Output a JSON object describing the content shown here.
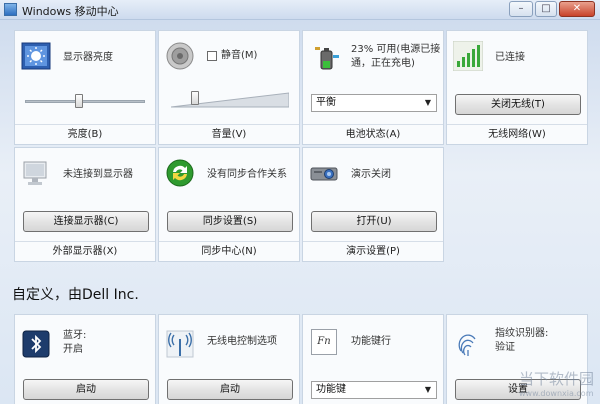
{
  "window": {
    "title": "Windows 移动中心",
    "controls": [
      "–",
      "□",
      "✕"
    ]
  },
  "tiles": {
    "brightness": {
      "label": "显示器亮度",
      "footer": "亮度(B)",
      "level": 0.45
    },
    "volume": {
      "mute_label": "静音(M)",
      "footer": "音量(V)",
      "level": 0.2
    },
    "battery": {
      "status": "23% 可用(电源已接通，正在充电)",
      "plan": "平衡",
      "footer": "电池状态(A)"
    },
    "wireless": {
      "status": "已连接",
      "button": "关闭无线(T)",
      "footer": "无线网络(W)"
    },
    "display": {
      "status": "未连接到显示器",
      "button": "连接显示器(C)",
      "footer": "外部显示器(X)"
    },
    "sync": {
      "status": "没有同步合作关系",
      "button": "同步设置(S)",
      "footer": "同步中心(N)"
    },
    "presentation": {
      "status": "演示关闭",
      "button": "打开(U)",
      "footer": "演示设置(P)"
    }
  },
  "custom_section": {
    "title": "自定义，由Dell Inc."
  },
  "custom_tiles": {
    "bluetooth": {
      "label_line1": "蓝牙:",
      "label_line2": "开启",
      "button": "启动"
    },
    "radio": {
      "label": "无线电控制选项",
      "button": "启动"
    },
    "fnkey": {
      "label": "功能键行",
      "icon_text": "Fn",
      "select": "功能键"
    },
    "fingerprint": {
      "label_line1": "指纹识别器:",
      "label_line2": "验证",
      "button": "设置"
    }
  },
  "watermark": {
    "line1": "当下软件园",
    "line2": "www.downxia.com"
  }
}
